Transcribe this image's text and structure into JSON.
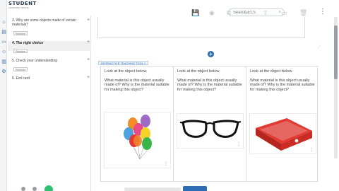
{
  "logo": {
    "name": "STUDENT",
    "tagline": "LEARNING SPACE"
  },
  "search": {
    "placeholder": "Search ELS",
    "icon": "search-icon"
  },
  "toolbar": [
    {
      "name": "save-icon",
      "glyph": "💾",
      "active": true
    },
    {
      "name": "preview-icon",
      "glyph": "◉",
      "active": false
    },
    {
      "name": "copy-icon",
      "glyph": "⧉",
      "active": false
    },
    {
      "name": "send-icon",
      "glyph": "➦",
      "active": false
    },
    {
      "name": "share-icon",
      "glyph": "⇪",
      "active": false
    },
    {
      "name": "layout-icon",
      "glyph": "▭",
      "active": false
    },
    {
      "name": "delete-icon",
      "glyph": "🗑",
      "active": false
    }
  ],
  "sidebar": {
    "items": [
      {
        "label": "3. Why are some objects made of certain materials?",
        "tag": "Session"
      },
      {
        "label": "4. The right choice",
        "tag": "Session"
      },
      {
        "label": "5. Check your understanding",
        "tag": "Session"
      },
      {
        "label": "6. Exit card",
        "tag": ""
      }
    ]
  },
  "tool": {
    "tag": "INTERACTIVE TEACHING TOOL 1",
    "cards": [
      {
        "q1": "Look at the object below.",
        "q2": "What material is this object usually\nmade of? Why is the material suitable for making this object?",
        "image": "balloons-image"
      },
      {
        "q1": "Look at the object below.",
        "q2": "What material is this object usually\nmade of? Why is the material suitable for making this object?",
        "image": "glasses-image"
      },
      {
        "q1": "Look at the object below.",
        "q2": "What material is this object usually\nmade of? Why is the material suitable for making this object?",
        "image": "binder-image"
      }
    ]
  },
  "colors": {
    "accent": "#2d6db5",
    "chat": "#2fbf71"
  }
}
